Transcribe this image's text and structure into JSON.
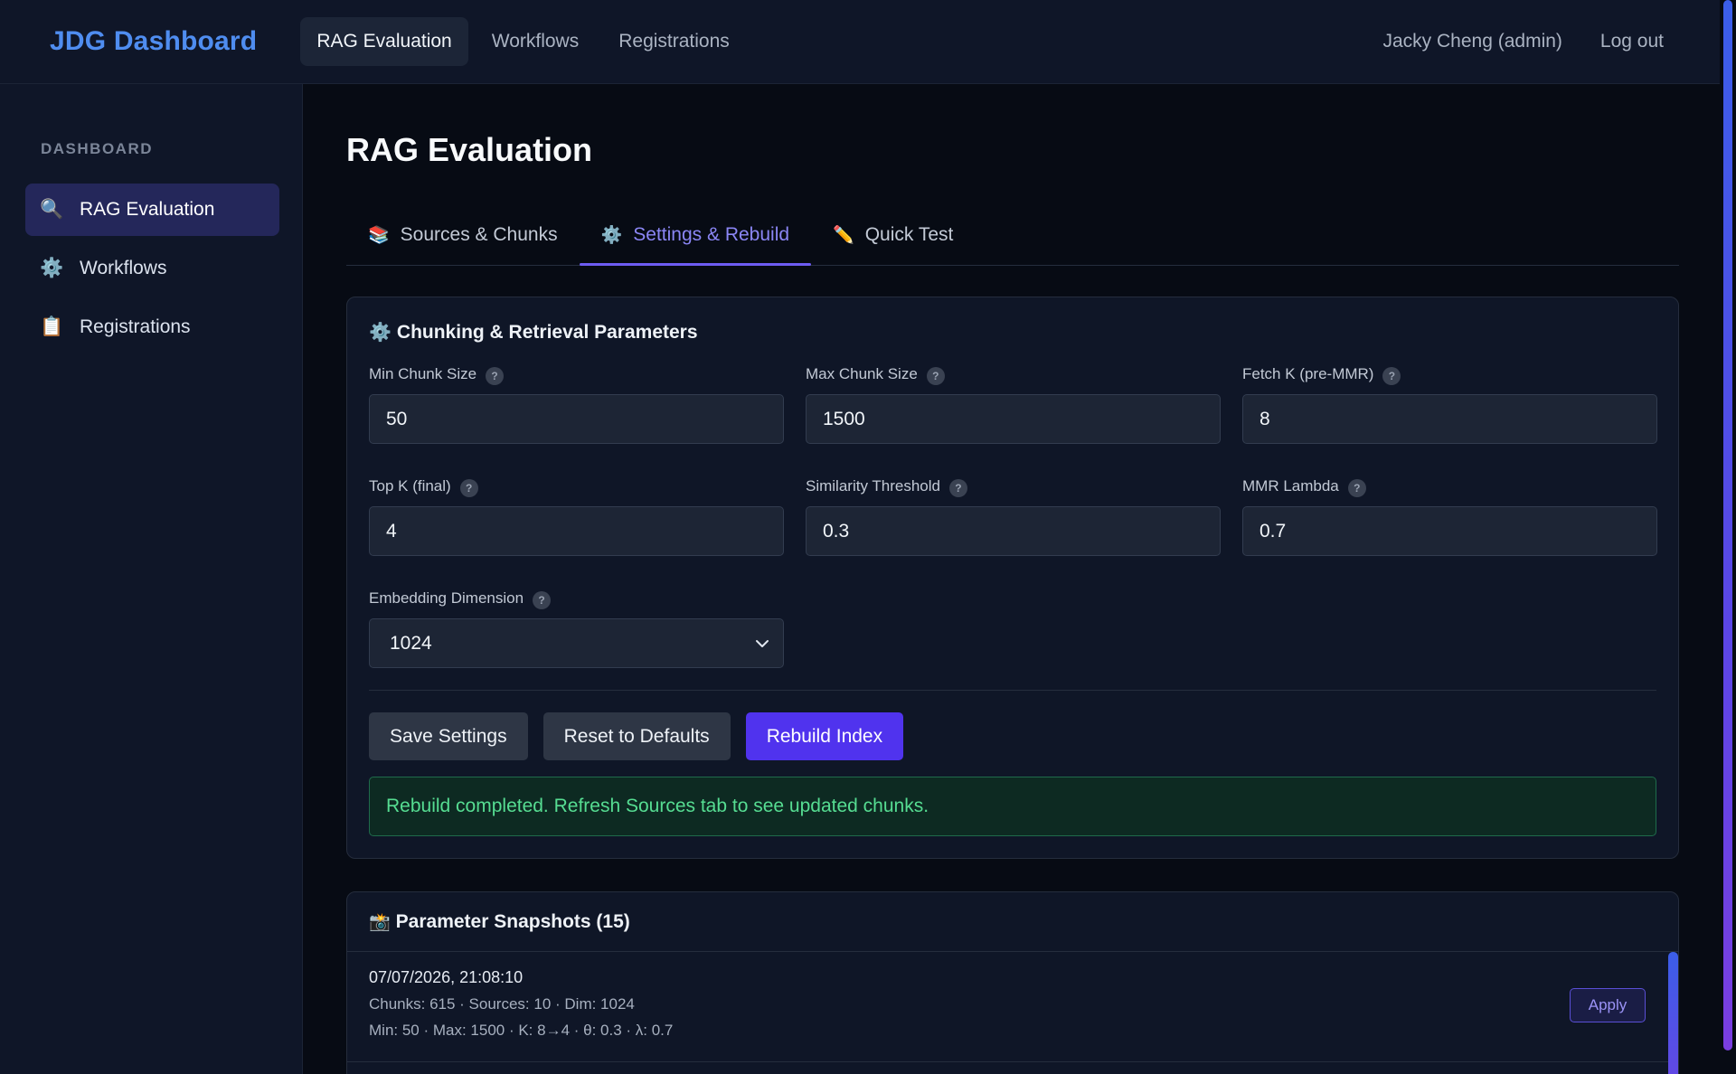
{
  "topbar": {
    "brand": "JDG Dashboard",
    "nav": [
      {
        "label": "RAG Evaluation",
        "active": true
      },
      {
        "label": "Workflows",
        "active": false
      },
      {
        "label": "Registrations",
        "active": false
      }
    ],
    "user": "Jacky Cheng (admin)",
    "logout": "Log out"
  },
  "sidebar": {
    "heading": "DASHBOARD",
    "items": [
      {
        "label": "RAG Evaluation",
        "icon": "magnifier-icon",
        "glyph": "🔍",
        "active": true
      },
      {
        "label": "Workflows",
        "icon": "gear-icon",
        "glyph": "⚙️",
        "active": false
      },
      {
        "label": "Registrations",
        "icon": "clipboard-icon",
        "glyph": "📋",
        "active": false
      }
    ]
  },
  "main": {
    "title": "RAG Evaluation",
    "tabs": [
      {
        "label": "Sources & Chunks",
        "icon": "books-icon",
        "glyph": "📚",
        "active": false
      },
      {
        "label": "Settings & Rebuild",
        "icon": "gear-icon",
        "glyph": "⚙️",
        "active": true
      },
      {
        "label": "Quick Test",
        "icon": "pencil-icon",
        "glyph": "✏️",
        "active": false
      }
    ]
  },
  "params": {
    "title": "Chunking & Retrieval Parameters",
    "title_glyph": "⚙️",
    "help_glyph": "?",
    "fields": [
      {
        "label": "Min Chunk Size",
        "value": "50"
      },
      {
        "label": "Max Chunk Size",
        "value": "1500"
      },
      {
        "label": "Fetch K (pre-MMR)",
        "value": "8"
      },
      {
        "label": "Top K (final)",
        "value": "4"
      },
      {
        "label": "Similarity Threshold",
        "value": "0.3"
      },
      {
        "label": "MMR Lambda",
        "value": "0.7"
      }
    ],
    "embedding": {
      "label": "Embedding Dimension",
      "value": "1024"
    },
    "buttons": {
      "save": "Save Settings",
      "reset": "Reset to Defaults",
      "rebuild": "Rebuild Index"
    },
    "alert": "Rebuild completed. Refresh Sources tab to see updated chunks."
  },
  "snapshots": {
    "title": "Parameter Snapshots (15)",
    "title_glyph": "📸",
    "items": [
      {
        "date": "07/07/2026, 21:08:10",
        "line1": "Chunks: 615 · Sources: 10 · Dim: 1024",
        "line2": "Min: 50 · Max: 1500 · K: 8→4 · θ: 0.3 · λ: 0.7",
        "apply": "Apply"
      }
    ]
  },
  "colors": {
    "accent": "#5033ee",
    "brand": "#4f8df0",
    "success": "#4ade80",
    "background": "#070b14"
  }
}
